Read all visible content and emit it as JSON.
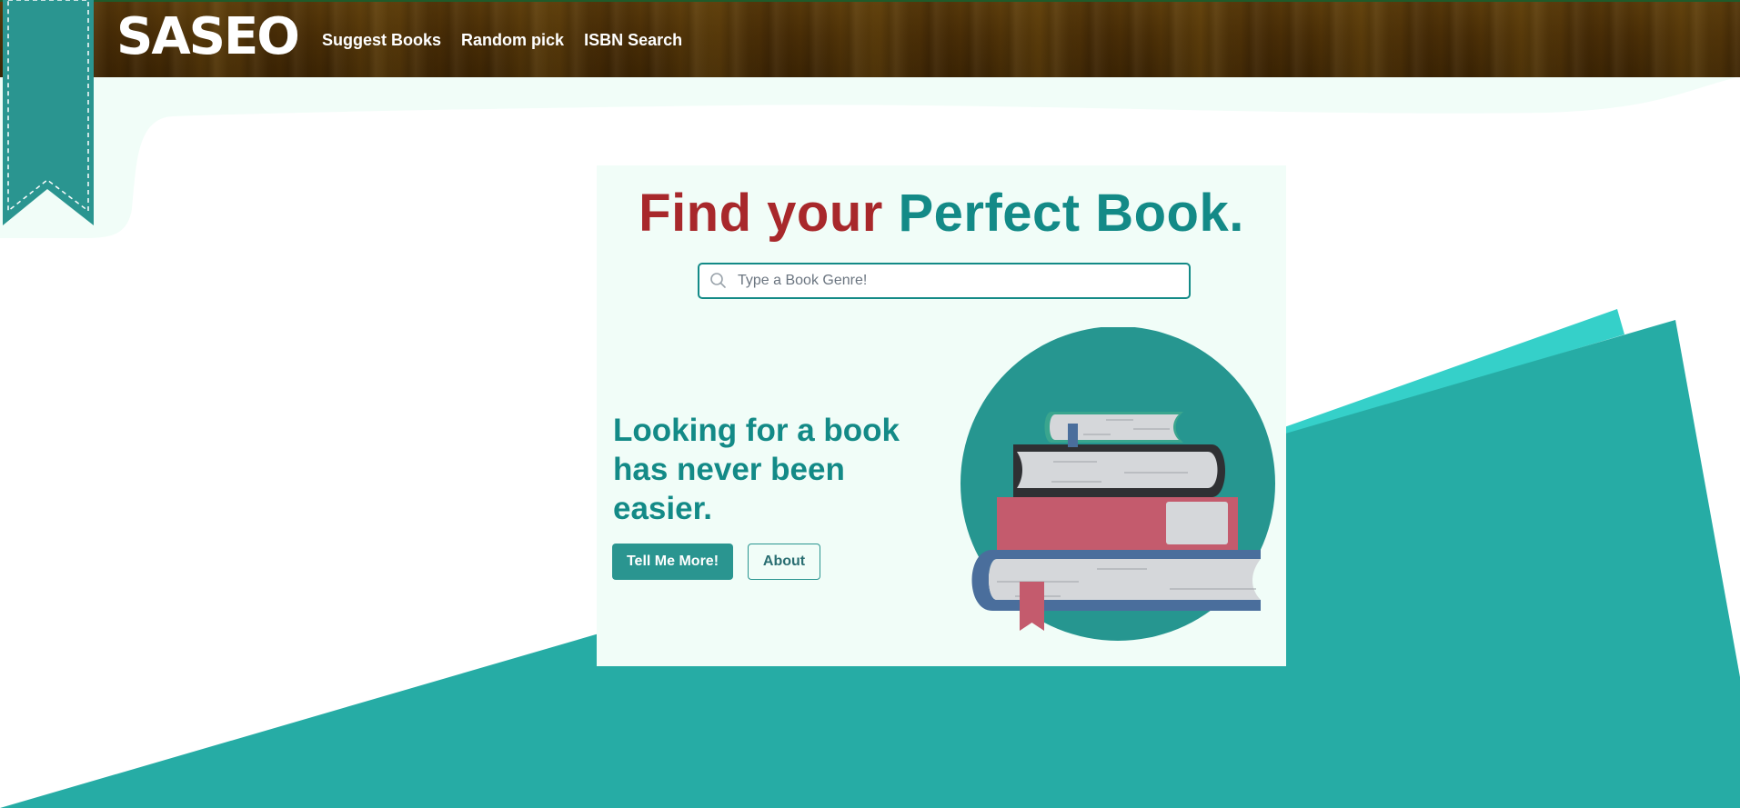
{
  "header": {
    "logo_text": "SASEO",
    "nav": [
      {
        "label": "Suggest Books"
      },
      {
        "label": "Random pick"
      },
      {
        "label": "ISBN Search"
      }
    ]
  },
  "hero": {
    "headline_part1": "Find your",
    "headline_part2": "Perfect Book.",
    "search": {
      "placeholder": "Type a Book Genre!",
      "value": ""
    },
    "tagline": "Looking for a book has never been easier.",
    "primary_button": "Tell Me More!",
    "secondary_button": "About"
  },
  "colors": {
    "accent_teal": "#2a9590",
    "headline_red": "#a8282b",
    "headline_teal": "#138a87",
    "wood": "#4a2e06",
    "mint": "#f1fdf8"
  },
  "icons": [
    "bookmark-ribbon-icon",
    "search-icon",
    "book-stack-illustration"
  ]
}
